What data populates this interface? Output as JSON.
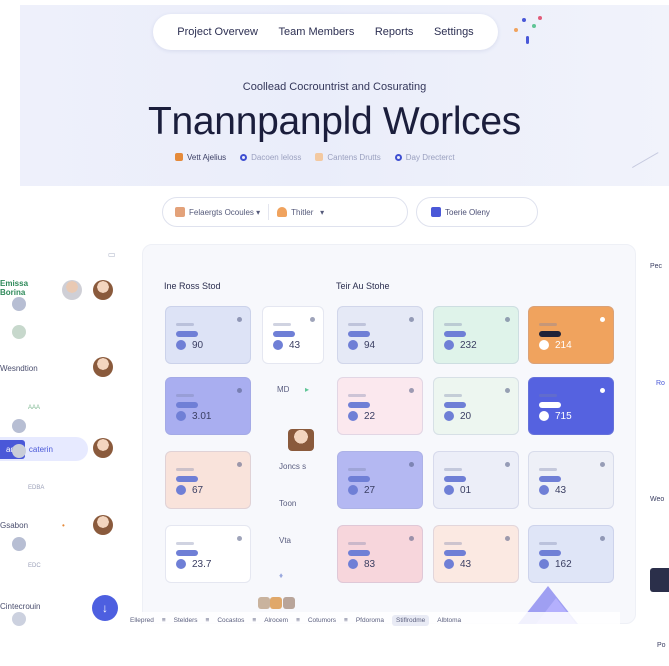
{
  "nav": {
    "items": [
      "Project Overvew",
      "Team Members",
      "Reports",
      "Settings"
    ]
  },
  "hero": {
    "subtitle": "Coollead Cocrountrist and Cosurating",
    "title": "Tnannpanpld Worlces",
    "meta": [
      "Vett Ajelius",
      "Dacoen leloss",
      "Cantens Drutts",
      "Day Drecterct"
    ]
  },
  "filters": {
    "team_select": "Felaergts Ocoules",
    "type_select": "Thitler",
    "button": "Toerie Oleny"
  },
  "left_panel": {
    "items": [
      {
        "text": "Emissa\nBorina",
        "color": "#2f8a5a"
      },
      {
        "text": "Wesndtion",
        "color": "#4a4e6e"
      },
      {
        "text": "AAA",
        "color": "#7fb892"
      },
      {
        "text": "caterin",
        "color": "#4a58d8"
      },
      {
        "text": "EDBA",
        "color": "#9ba0b8"
      },
      {
        "text": "Gsabon",
        "color": "#4a4e6e"
      },
      {
        "text": "EDC",
        "color": "#9ba0b8"
      },
      {
        "text": "Cintecrouin",
        "color": "#4a4e6e"
      }
    ],
    "fab_icon": "download-icon"
  },
  "board": {
    "section_left": "Ine Ross Stod",
    "section_right": "Teir Au Stohe",
    "cards": [
      {
        "value": "90",
        "bg": "#dde3f6"
      },
      {
        "value": "43",
        "bg": "#ffffff"
      },
      {
        "value": "94",
        "bg": "#e5e9f6"
      },
      {
        "value": "232",
        "bg": "#dff3ea"
      },
      {
        "value": "214",
        "bg": "#f0a35e"
      },
      {
        "value": "3.01",
        "bg": "#a9aef0"
      },
      {
        "value": "22",
        "bg": "#fbe8ee"
      },
      {
        "value": "20",
        "bg": "#edf6f0"
      },
      {
        "value": "715",
        "bg": "#5562e0"
      },
      {
        "value": "67",
        "bg": "#f9e3db"
      },
      {
        "value": "27",
        "bg": "#b4b8f2"
      },
      {
        "value": "01",
        "bg": "#eceef8"
      },
      {
        "value": "43",
        "bg": "#eef0f7"
      },
      {
        "value": "23.7",
        "bg": "#ffffff"
      },
      {
        "value": "83",
        "bg": "#f7d6dc"
      },
      {
        "value": "43",
        "bg": "#fbe9e2"
      },
      {
        "value": "162",
        "bg": "#dfe5f7"
      }
    ],
    "mini_labels": [
      "MD",
      "Joncs s",
      "Toon",
      "Vta"
    ]
  },
  "bottom_bar": {
    "items": [
      "Ellepred",
      "Stelders",
      "Cocastos",
      "Alrocem",
      "Cotumors",
      "Pfdoroma",
      "Stiflrodme",
      "Albtoma"
    ]
  },
  "right_panel": {
    "labels": [
      "Pec",
      "Ro",
      "Weo",
      "Po"
    ]
  },
  "colors": {
    "accent": "#4a58d8",
    "orange": "#f0a35e"
  }
}
